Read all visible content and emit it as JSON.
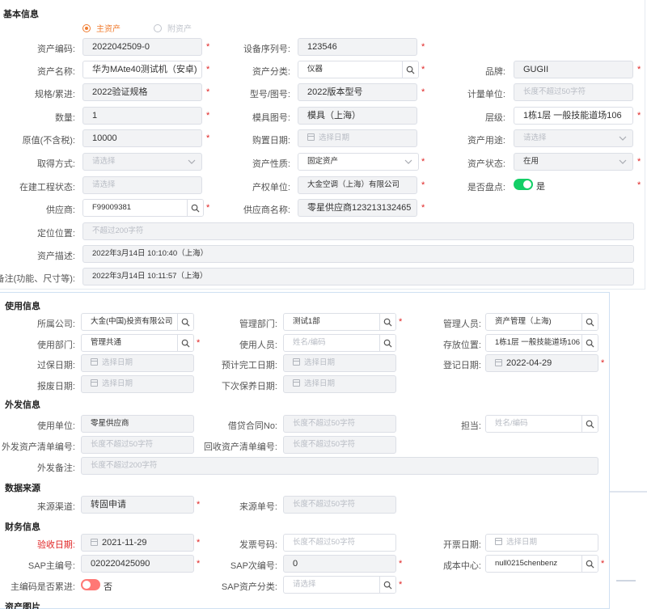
{
  "basic": {
    "title": "基本信息",
    "radio_main": "主资产",
    "radio_sub": "附资产",
    "asset_code_label": "资产编码:",
    "asset_code": "2022042509-0",
    "serial_label": "设备序列号:",
    "serial": "123546",
    "asset_name_label": "资产名称:",
    "asset_name": "华为MAte40测试机（安卓)",
    "category_label": "资产分类:",
    "category": "仪器",
    "brand_label": "品牌:",
    "brand": "GUGII",
    "spec_label": "规格/累进:",
    "spec": "2022验证规格",
    "model_label": "型号/图号:",
    "model": "2022版本型号",
    "unit_label": "计量单位:",
    "unit_placeholder": "长度不超过50字符",
    "qty_label": "数量:",
    "qty": "1",
    "mold_label": "模具图号:",
    "mold": "模具（上海）",
    "level_label": "层级:",
    "level": "1栋1层 一般技能道场106",
    "price_label": "原值(不含税):",
    "price": "10000",
    "buy_date_label": "购置日期:",
    "buy_date_placeholder": "选择日期",
    "usage_label": "资产用途:",
    "usage_placeholder": "请选择",
    "acquire_label": "取得方式:",
    "acquire_placeholder": "请选择",
    "nature_label": "资产性质:",
    "nature": "固定资产",
    "status_label": "资产状态:",
    "status": "在用",
    "construction_label": "在建工程状态:",
    "construction_placeholder": "请选择",
    "owner_label": "产权单位:",
    "owner": "大金空调（上海）有限公司",
    "inventory_label": "是否盘点:",
    "inventory_value": "是",
    "supplier_label": "供应商:",
    "supplier": "F99009381",
    "supplier_name_label": "供应商名称:",
    "supplier_name": "零星供应商123213132465",
    "location_label": "定位位置:",
    "location_placeholder": "不超过200字符",
    "desc_label": "资产描述:",
    "desc": "2022年3月14日 10:10:40（上海）",
    "remark_label": "备注(功能、尺寸等):",
    "remark": "2022年3月14日 10:11:57（上海）"
  },
  "usage": {
    "title": "使用信息",
    "company_label": "所属公司:",
    "company": "大金(中国)投资有限公司",
    "mgmt_dept_label": "管理部门:",
    "mgmt_dept": "测试1部",
    "manager_label": "管理人员:",
    "manager": "资产管理（上海)",
    "use_dept_label": "使用部门:",
    "use_dept": "管理共通",
    "user_label": "使用人员:",
    "user_placeholder": "姓名/编码",
    "storage_label": "存放位置:",
    "storage": "1栋1层 一般技能道场106",
    "warranty_label": "过保日期:",
    "warranty_placeholder": "选择日期",
    "complete_label": "预计完工日期:",
    "complete_placeholder": "选择日期",
    "register_label": "登记日期:",
    "register": "2022-04-29",
    "scrap_label": "报废日期:",
    "scrap_placeholder": "选择日期",
    "maint_label": "下次保养日期:",
    "maint_placeholder": "选择日期"
  },
  "external": {
    "title": "外发信息",
    "unit_label": "使用单位:",
    "unit": "零星供应商",
    "contract_label": "借贷合同No:",
    "contract_placeholder": "长度不超过50字符",
    "owner_label": "担当:",
    "owner_placeholder": "姓名/编码",
    "out_list_label": "外发资产清单编号:",
    "out_list_placeholder": "长度不超过50字符",
    "back_list_label": "回收资产清单编号:",
    "back_list_placeholder": "长度不超过50字符",
    "remark_label": "外发备注:",
    "remark_placeholder": "长度不超过200字符"
  },
  "source": {
    "title": "数据来源",
    "channel_label": "来源渠道:",
    "channel": "转固申请",
    "doc_label": "来源单号:",
    "doc_placeholder": "长度不超过50字符"
  },
  "finance": {
    "title": "财务信息",
    "accept_label": "验收日期:",
    "accept": "2021-11-29",
    "invoice_no_label": "发票号码:",
    "invoice_no_placeholder": "长度不超过50字符",
    "invoice_date_label": "开票日期:",
    "invoice_date_placeholder": "选择日期",
    "sap_main_label": "SAP主编号:",
    "sap_main": "020220425090",
    "sap_sub_label": "SAP次编号:",
    "sap_sub": "0",
    "cost_center_label": "成本中心:",
    "cost_center": "null0215chenbenz",
    "main_sub_label": "主编码是否累进:",
    "main_sub_value": "否",
    "sap_class_label": "SAP资产分类:",
    "sap_class_placeholder": "请选择"
  },
  "images": {
    "title": "资产图片"
  },
  "colors": {
    "accent": "#f07b2e",
    "required": "#e02424",
    "toggle_on": "#13ce66",
    "toggle_off": "#ff7875"
  }
}
